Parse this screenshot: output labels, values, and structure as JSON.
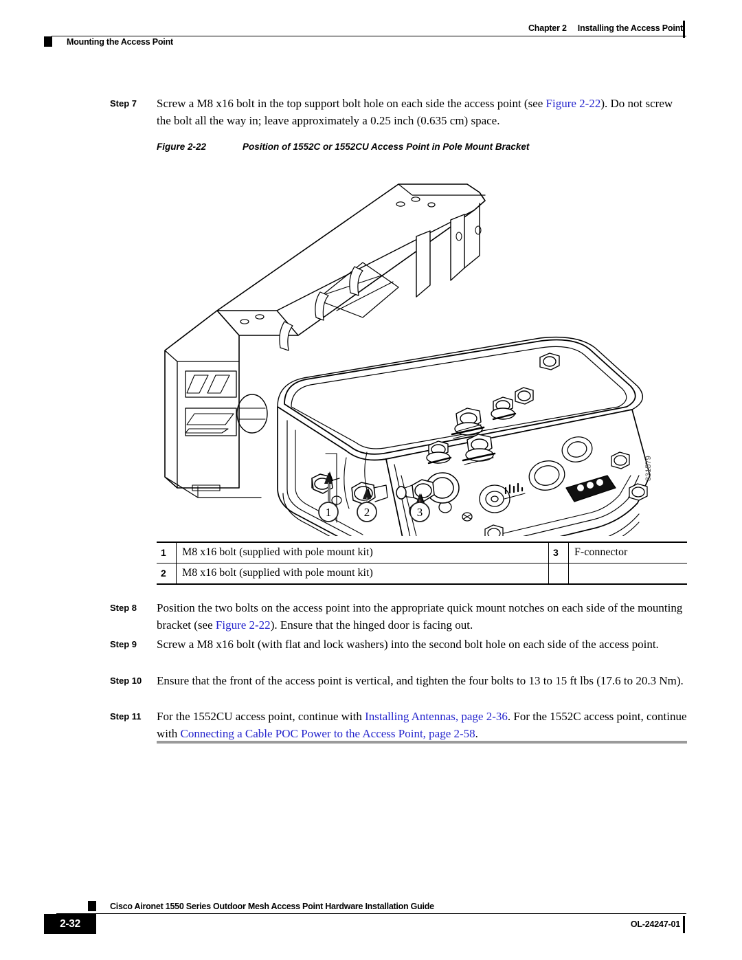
{
  "header": {
    "chapter_number": "Chapter 2",
    "chapter_title": "Installing the Access Point",
    "section_title": "Mounting the Access Point"
  },
  "steps": [
    {
      "label": "Step 7",
      "text_parts": [
        {
          "t": "Screw a M8 x16 bolt in the top support bolt hole on each side the access point (see ",
          "link": false
        },
        {
          "t": "Figure 2-22",
          "link": true
        },
        {
          "t": "). Do not screw the bolt all the way in; leave approximately a 0.25 inch (0.635 cm) space.",
          "link": false
        }
      ]
    },
    {
      "label": "Step 8",
      "text_parts": [
        {
          "t": "Position the two bolts on the access point into the appropriate quick mount notches on each side of the mounting bracket (see ",
          "link": false
        },
        {
          "t": "Figure 2-22",
          "link": true
        },
        {
          "t": "). Ensure that the hinged door is facing out.",
          "link": false
        }
      ]
    },
    {
      "label": "Step 9",
      "text_parts": [
        {
          "t": "Screw a M8 x16 bolt (with flat and lock washers) into the second bolt hole on each side of the access point.",
          "link": false
        }
      ]
    },
    {
      "label": "Step 10",
      "text_parts": [
        {
          "t": "Ensure that the front of the access point is vertical, and tighten the four bolts to 13 to 15 ft lbs (17.6 to 20.3 Nm).",
          "link": false
        }
      ]
    },
    {
      "label": "Step 11",
      "text_parts": [
        {
          "t": "For the 1552CU access point, continue with ",
          "link": false
        },
        {
          "t": "Installing Antennas, page 2-36",
          "link": true
        },
        {
          "t": ". For the 1552C access point, continue with ",
          "link": false
        },
        {
          "t": "Connecting a Cable POC Power to the Access Point, page 2-58",
          "link": true
        },
        {
          "t": ".",
          "link": false
        }
      ]
    }
  ],
  "figure": {
    "number": "Figure 2-22",
    "title": "Position of 1552C or 1552CU Access Point in Pole Mount Bracket",
    "graphic_id": "331579",
    "callouts": [
      "1",
      "2",
      "3"
    ],
    "description": "Isometric line drawing of a Cisco 1552C/1552CU outdoor access point seated in a pole mount bracket, showing bolts and an F-connector on the lower side panel."
  },
  "legend": {
    "rows": [
      {
        "num_left": "1",
        "text_left": "M8 x16 bolt (supplied with pole mount kit)",
        "num_right": "3",
        "text_right": "F-connector"
      },
      {
        "num_left": "2",
        "text_left": "M8 x16 bolt (supplied with pole mount kit)",
        "num_right": "",
        "text_right": ""
      }
    ]
  },
  "footer": {
    "page_number": "2-32",
    "document_title": "Cisco Aironet 1550 Series Outdoor Mesh Access Point Hardware Installation Guide",
    "document_id": "OL-24247-01"
  },
  "colors": {
    "link": "#2222cc",
    "rule": "#9a9a9a",
    "text": "#000000"
  }
}
